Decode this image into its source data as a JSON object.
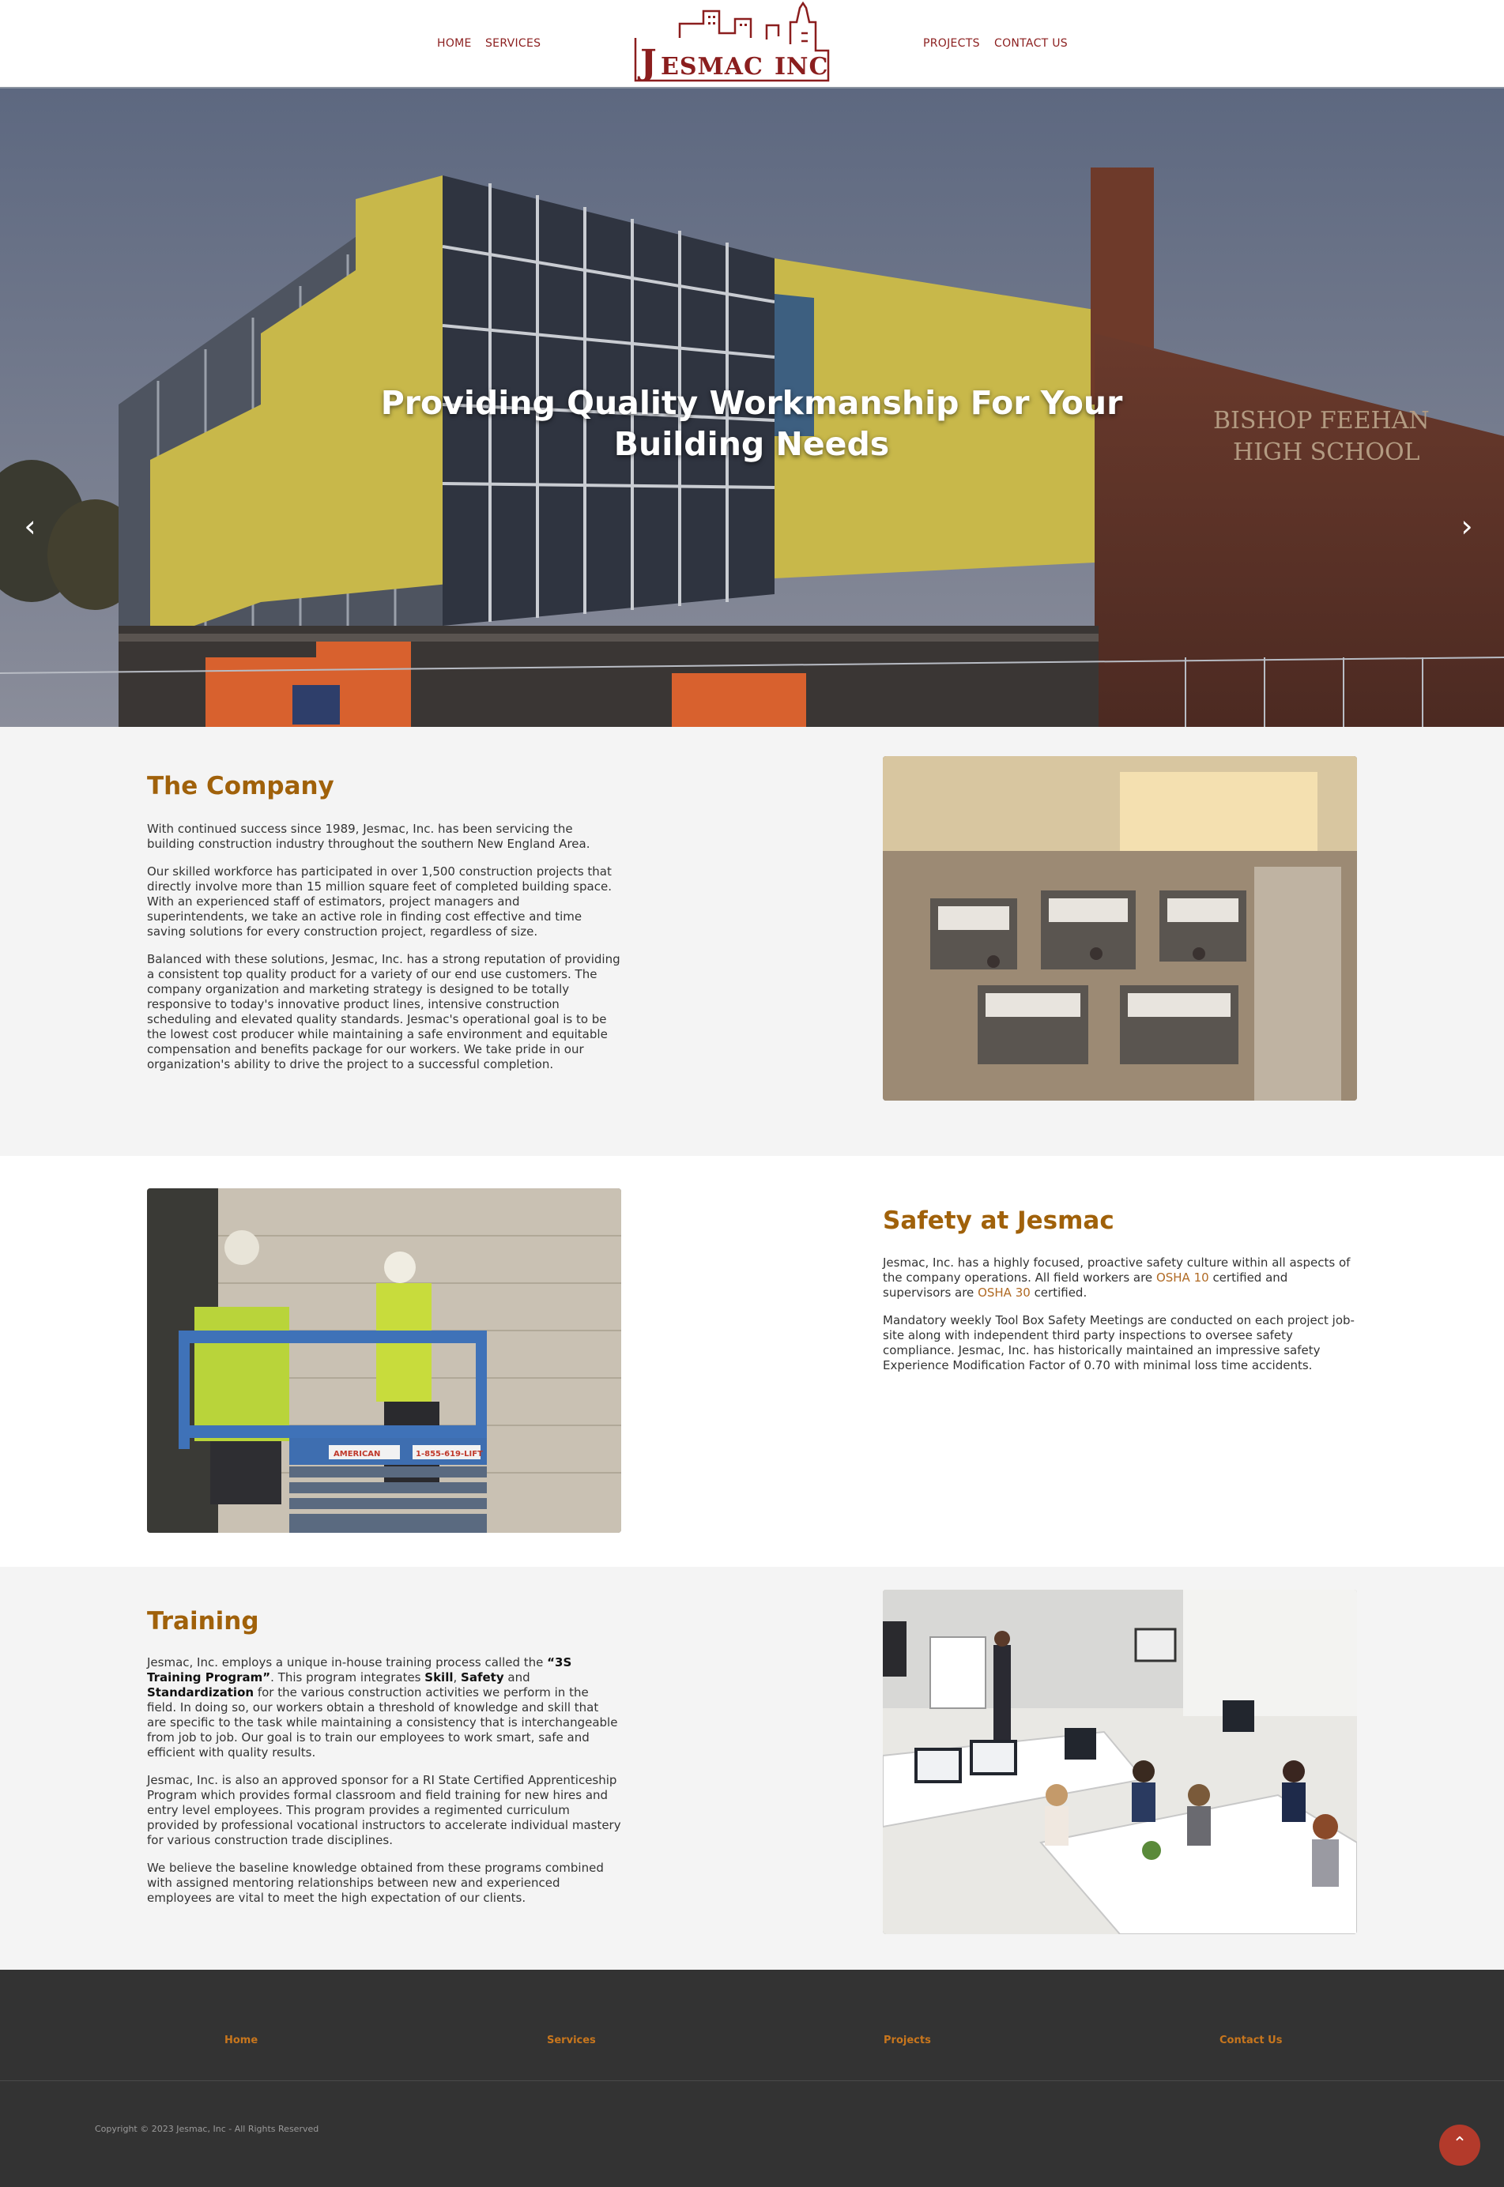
{
  "brand": {
    "logo_text": "JESMAC INC",
    "primary_color": "#8b1e1e",
    "accent_color": "#a0610a"
  },
  "nav": {
    "items": [
      {
        "label": "HOME"
      },
      {
        "label": "SERVICES"
      },
      {
        "label": "PROJECTS"
      },
      {
        "label": "CONTACT US"
      }
    ]
  },
  "hero": {
    "title": "Providing Quality Workmanship For Your Building Needs",
    "prev_icon": "chevron-left-icon",
    "next_icon": "chevron-right-icon",
    "sign_text": "BISHOP FEEHAN HIGH SCHOOL"
  },
  "company": {
    "heading": "The Company",
    "paragraphs": [
      "With continued success since 1989, Jesmac, Inc. has been servicing the building construction industry throughout the southern New England Area.",
      "Our skilled workforce has participated in over 1,500 construction projects that directly involve more than 15 million square feet of completed building space. With an experienced staff of estimators, project managers and superintendents, we take an active role in finding cost effective and time saving solutions for every construction project, regardless of size.",
      "Balanced with these solutions, Jesmac, Inc. has a strong reputation of providing a consistent top quality product for a variety of our end use customers. The company organization and marketing strategy is designed to be totally responsive to today's innovative product lines, intensive construction scheduling and elevated quality standards. Jesmac's operational goal is to be the lowest cost producer while maintaining a safe environment and equitable compensation and benefits package for our workers. We take pride in our organization's ability to drive the project to a successful completion."
    ]
  },
  "safety": {
    "heading": "Safety at Jesmac",
    "p1_a": "Jesmac, Inc. has a highly focused, proactive safety culture within all aspects of the company operations. All field workers are ",
    "osha10": "OSHA 10",
    "p1_b": " certified and supervisors are ",
    "osha30": "OSHA 30",
    "p1_c": " certified.",
    "p2": "Mandatory weekly Tool Box Safety Meetings are conducted on each project job-site along with independent third party inspections to oversee safety compliance. Jesmac, Inc. has historically maintained an impressive safety Experience Modification Factor of 0.70 with minimal loss time accidents.",
    "lift_label": "AMERICAN",
    "lift_phone": "1-855-619-LIFT"
  },
  "training": {
    "heading": "Training",
    "p1_a": "Jesmac, Inc. employs a unique in-house training process called the ",
    "program": "“3S Training Program”",
    "p1_b": ". This program integrates ",
    "skill": "Skill",
    "comma": ", ",
    "safety": "Safety",
    "and": " and ",
    "standardization": "Standardization",
    "p1_c": " for the various construction activities we perform in the field. In doing so, our workers obtain a threshold of knowledge and skill that are specific to the task while maintaining a consistency that is interchangeable from job to job. Our goal is to train our employees to work smart, safe and efficient with quality results.",
    "p2": "Jesmac, Inc. is also an approved sponsor for a RI State Certified Apprenticeship Program which provides formal classroom and field training for new hires and entry level employees. This program provides a regimented curriculum provided by professional vocational instructors to accelerate individual mastery for various construction trade disciplines.",
    "p3": "We believe the baseline knowledge obtained from these programs combined with assigned mentoring relationships between new and experienced employees are vital to meet the high expectation of our clients."
  },
  "footer": {
    "links": [
      {
        "label": "Home"
      },
      {
        "label": "Services"
      },
      {
        "label": "Projects"
      },
      {
        "label": "Contact Us"
      }
    ],
    "copyright": "Copyright © 2023 Jesmac, Inc - All Rights Reserved",
    "back_to_top_icon": "chevron-up-icon"
  }
}
